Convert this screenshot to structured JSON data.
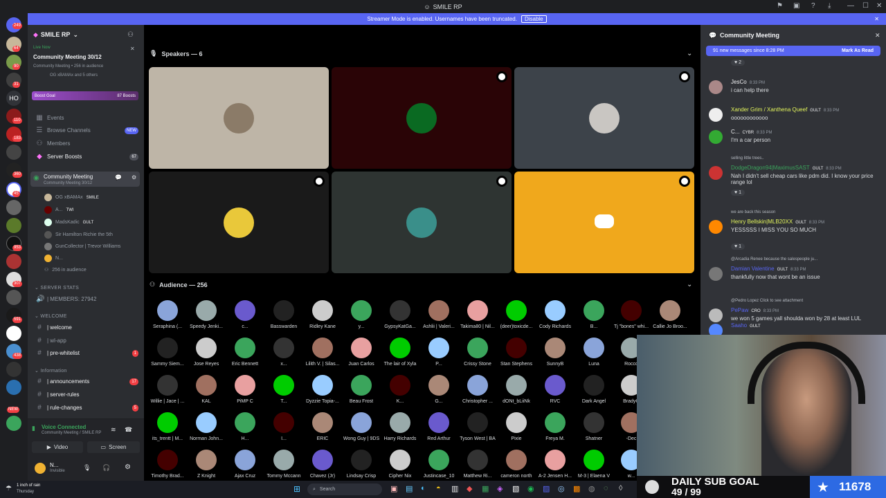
{
  "titlebar": {
    "title": "SMILE RP"
  },
  "streamer": {
    "text": "Streamer Mode is enabled. Usernames have been truncated.",
    "button": "Disable"
  },
  "guild_badges": [
    "249",
    "64",
    "90",
    "31",
    "HO",
    "110",
    "183",
    "360",
    "45",
    "953",
    "307",
    "591",
    "438",
    "NEW"
  ],
  "server": {
    "name": "SMILE RP",
    "live": "Live Now",
    "event_title": "Community Meeting 30/12",
    "event_sub": "Community Meeting • 256 in audience",
    "event_people": "OG xBAMAx and 5 others",
    "boost_goal": "Boost Goal",
    "boost_count": "87 Boosts"
  },
  "nav": [
    {
      "label": "Events"
    },
    {
      "label": "Browse Channels",
      "badge": "NEW"
    },
    {
      "label": "Members"
    },
    {
      "label": "Server Boosts",
      "count": "67"
    }
  ],
  "stage_channel": {
    "name": "Community Meeting",
    "sub": "Community Meeting 30/12"
  },
  "stage_members": [
    "OG xBAMAx",
    "A...",
    "MadsKadic",
    "Sir Hamilton Richie the 5th",
    "GunCollector | Trevor Williams",
    "N...",
    "256 in audience"
  ],
  "member_tags": [
    "SMILE",
    "TWI",
    "GULT"
  ],
  "categories": {
    "stats": "SERVER STATS",
    "members": "| MEMBERS: 27942",
    "welcome": "WELCOME",
    "info": "Information"
  },
  "channels": [
    {
      "name": "| welcome"
    },
    {
      "name": "| wl-app"
    },
    {
      "name": "| pre-whitelist",
      "count": "1"
    },
    {
      "name": "| announcements",
      "count": "17"
    },
    {
      "name": "| server-rules"
    },
    {
      "name": "| rule-changes",
      "count": "5"
    }
  ],
  "voice": {
    "status": "Voice Connected",
    "sub": "Community Meeting / SMILE RP",
    "video": "Video",
    "screen": "Screen"
  },
  "user": {
    "name": "N...",
    "status": "Invisible"
  },
  "speakers": {
    "label": "Speakers — 6"
  },
  "audience": {
    "label": "Audience — 256",
    "rows": [
      [
        "Seraphina (...",
        "Speedy Jenki...",
        "c...",
        "Basswarden",
        "Ridley Kane",
        "y...",
        "GypsyKatGa...",
        "Ashlii | Valeri...",
        "Takima80 | Nil...",
        "(deer)toxicde...",
        "Cody Richards",
        "B...",
        "Tj \"bones\" whi...",
        "Callie Jo Broo..."
      ],
      [
        "Sammy Siem...",
        "Jose Reyes",
        "Eric Bennett",
        "x...",
        "Lilith V. | Silas...",
        "Juan Carlos",
        "The lair of Xyla",
        "P...",
        "Crissy Stone",
        "Stan Stephens",
        "SunnyB",
        "Luna",
        "Rocco"
      ],
      [
        "Willie | Jace | ...",
        "KAL",
        "PiMP C",
        "T...",
        "Dyzzie Topia-...",
        "Beau Frost",
        "K...",
        "G...",
        "Christopher ...",
        "dONt_bLiiNk",
        "RVC",
        "Dark Angel",
        "BradyG"
      ],
      [
        "its_trentt | M...",
        "Norman John...",
        "H...",
        "I...",
        "ERIC",
        "Wong Guy | 9DS",
        "Harry Richards",
        "Red Arthur",
        "Tyson West | BA",
        "Pixie",
        "Freya M.",
        "Shatner",
        "-Dec"
      ],
      [
        "Timothy Brad...",
        "Z Knight",
        "Ajax Cruz",
        "Tommy Mccann",
        "Chavez (Jr)",
        "Lindsay Crisp",
        "Cipher Nix",
        "Justincase_10",
        "Matthew Ri...",
        "cameron north",
        "A-2 Jensen H...",
        "M-3 | Elaena V",
        "w..."
      ]
    ]
  },
  "chat": {
    "title": "Community Meeting",
    "new_banner": "91 new messages since 8:28 PM",
    "mark_read": "Mark As Read",
    "top_reaction": "2",
    "messages": [
      {
        "name": "JesCo",
        "time": "8:33 PM",
        "text": "i can help there",
        "color": "#f2f3f5"
      },
      {
        "name": "Xander Grim / Xanthena Queef",
        "tag": "GULT",
        "time": "8:33 PM",
        "text": "oooooooooooo",
        "color": "#e3f55c"
      },
      {
        "name": "C...",
        "tag": "CYBR",
        "time": "8:33 PM",
        "text": "I'm a car person",
        "color": "#f2f3f5"
      },
      {
        "reply": "selling little trees..",
        "name": "DodgeDragon94|MaximusSAST",
        "tag": "GULT",
        "time": "8:33 PM",
        "text": "Nah I didn't sell cheap cars like pdm did. I know your price range lol",
        "color": "#3ba55c",
        "reaction": "1"
      },
      {
        "reply": "we are back this season",
        "name": "Henry Bellskin|MLB20XX",
        "tag": "GULT",
        "time": "8:33 PM",
        "text": "YESSSSS I MISS YOU SO MUCH",
        "color": "#e3f55c",
        "reaction": "1"
      },
      {
        "reply": "@Arcadia Renee  because the salespeople ju...",
        "name": "Damian Valentine",
        "tag": "GULT",
        "time": "8:33 PM",
        "text": "thankfully now that wont be an issue",
        "color": "#5865f2"
      },
      {
        "reply": "@Pedro Lopez  Click to see attachment",
        "name": "PePaw",
        "tag": "CRO",
        "time": "8:33 PM",
        "text": "we won 5 games yall shoulda won by 28 at least LUL",
        "color": "#5865f2"
      },
      {
        "name": "Saaho",
        "tag": "GULT",
        "time": "",
        "text": "",
        "color": "#5865f2"
      }
    ]
  },
  "subgoal": {
    "label": "DAILY SUB GOAL",
    "progress": "49 / 99",
    "count": "11678"
  },
  "taskbar": {
    "weather": "1 inch of rain",
    "day": "Thursday",
    "search": "Search"
  }
}
